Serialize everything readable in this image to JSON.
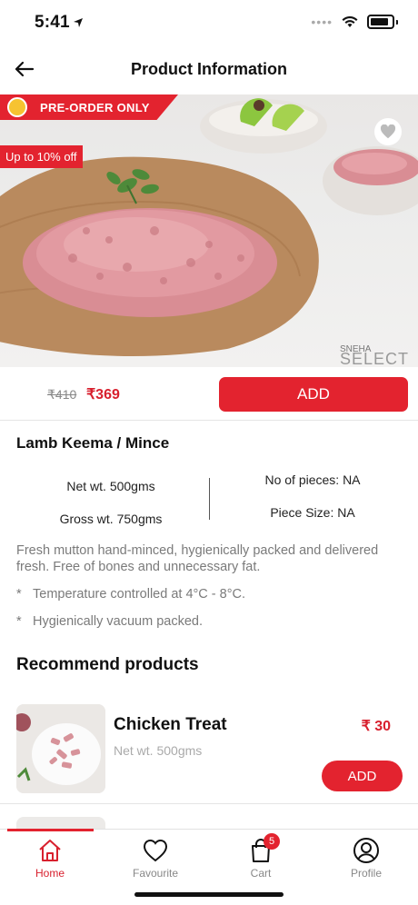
{
  "status_bar": {
    "time": "5:41"
  },
  "header": {
    "title": "Product Information"
  },
  "hero": {
    "preorder_label": "PRE-ORDER ONLY",
    "offer_label": "Up to 10% off",
    "brand_small": "SNEHA",
    "brand_big": "SELECT"
  },
  "pricing": {
    "old_price": "₹410",
    "new_price": "₹369",
    "add_label": "ADD"
  },
  "product": {
    "name": "Lamb Keema / Mince",
    "net_weight": "Net wt. 500gms",
    "gross_weight": "Gross wt. 750gms",
    "pieces": "No of pieces: NA",
    "piece_size": "Piece Size: NA",
    "description": "Fresh mutton hand-minced, hygienically packed and delivered fresh. Free of bones and unnecessary fat.",
    "bullets": [
      "Temperature controlled at 4°C - 8°C.",
      "Hygienically vacuum packed."
    ],
    "bullet_marker": "*"
  },
  "recommended": {
    "title": "Recommend products",
    "items": [
      {
        "name": "Chicken Treat",
        "weight": "Net wt. 500gms",
        "price": "₹ 30",
        "add_label": "ADD"
      }
    ]
  },
  "tab_bar": {
    "tabs": [
      {
        "label": "Home",
        "icon": "home-icon",
        "active": true
      },
      {
        "label": "Favourite",
        "icon": "heart-icon",
        "active": false
      },
      {
        "label": "Cart",
        "icon": "cart-bag-icon",
        "active": false,
        "badge": "5"
      },
      {
        "label": "Profile",
        "icon": "profile-icon",
        "active": false
      }
    ]
  },
  "colors": {
    "accent": "#e3232f",
    "price_red": "#d8202e",
    "muted_text": "#7a7a7a"
  }
}
